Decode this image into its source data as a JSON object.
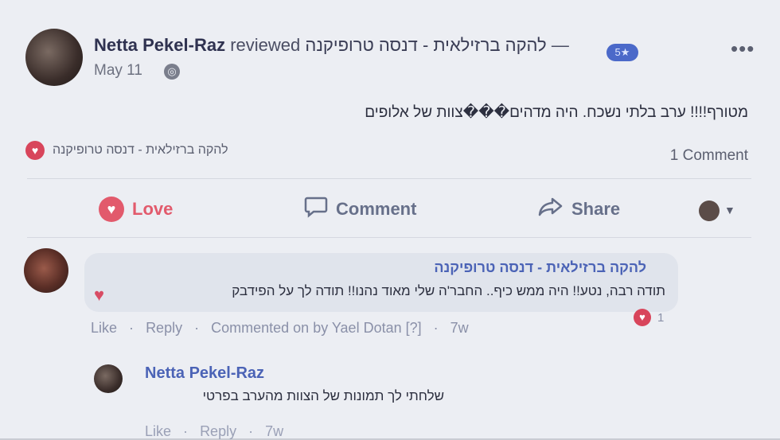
{
  "post": {
    "author": "Netta Pekel-Raz",
    "reviewed_label": "reviewed",
    "page": "להקה ברזילאית - דנסה טרופיקנה",
    "dash": "—",
    "rating": "5★",
    "date": "May 11",
    "more_icon": "more-options-icon",
    "text": "מטורף!!!! ערב בלתי נשכח. היה מדהים���צוות של אלופים",
    "reaction_page": "להקה ברזילאית - דנסה טרופיקנה",
    "comment_count": "1 Comment"
  },
  "actions": {
    "love": "Love",
    "comment": "Comment",
    "share": "Share"
  },
  "comments": [
    {
      "author": "להקה ברזילאית - דנסה טרופיקנה",
      "text": "תודה רבה, נטע!! היה ממש כיף.. החבר'ה שלי מאוד נהנו!! תודה לך על הפידבק",
      "like": "Like",
      "reply": "Reply",
      "commented_on": "Commented on by Yael Dotan [?]",
      "time": "7w",
      "reactions": "1",
      "replies": [
        {
          "author": "Netta Pekel-Raz",
          "text": "שלחתי לך תמונות של הצוות מהערב בפרטי",
          "like": "Like",
          "reply": "Reply",
          "time": "7w"
        }
      ]
    }
  ],
  "colors": {
    "accent": "#4b63b6",
    "love": "#e25a6c"
  }
}
